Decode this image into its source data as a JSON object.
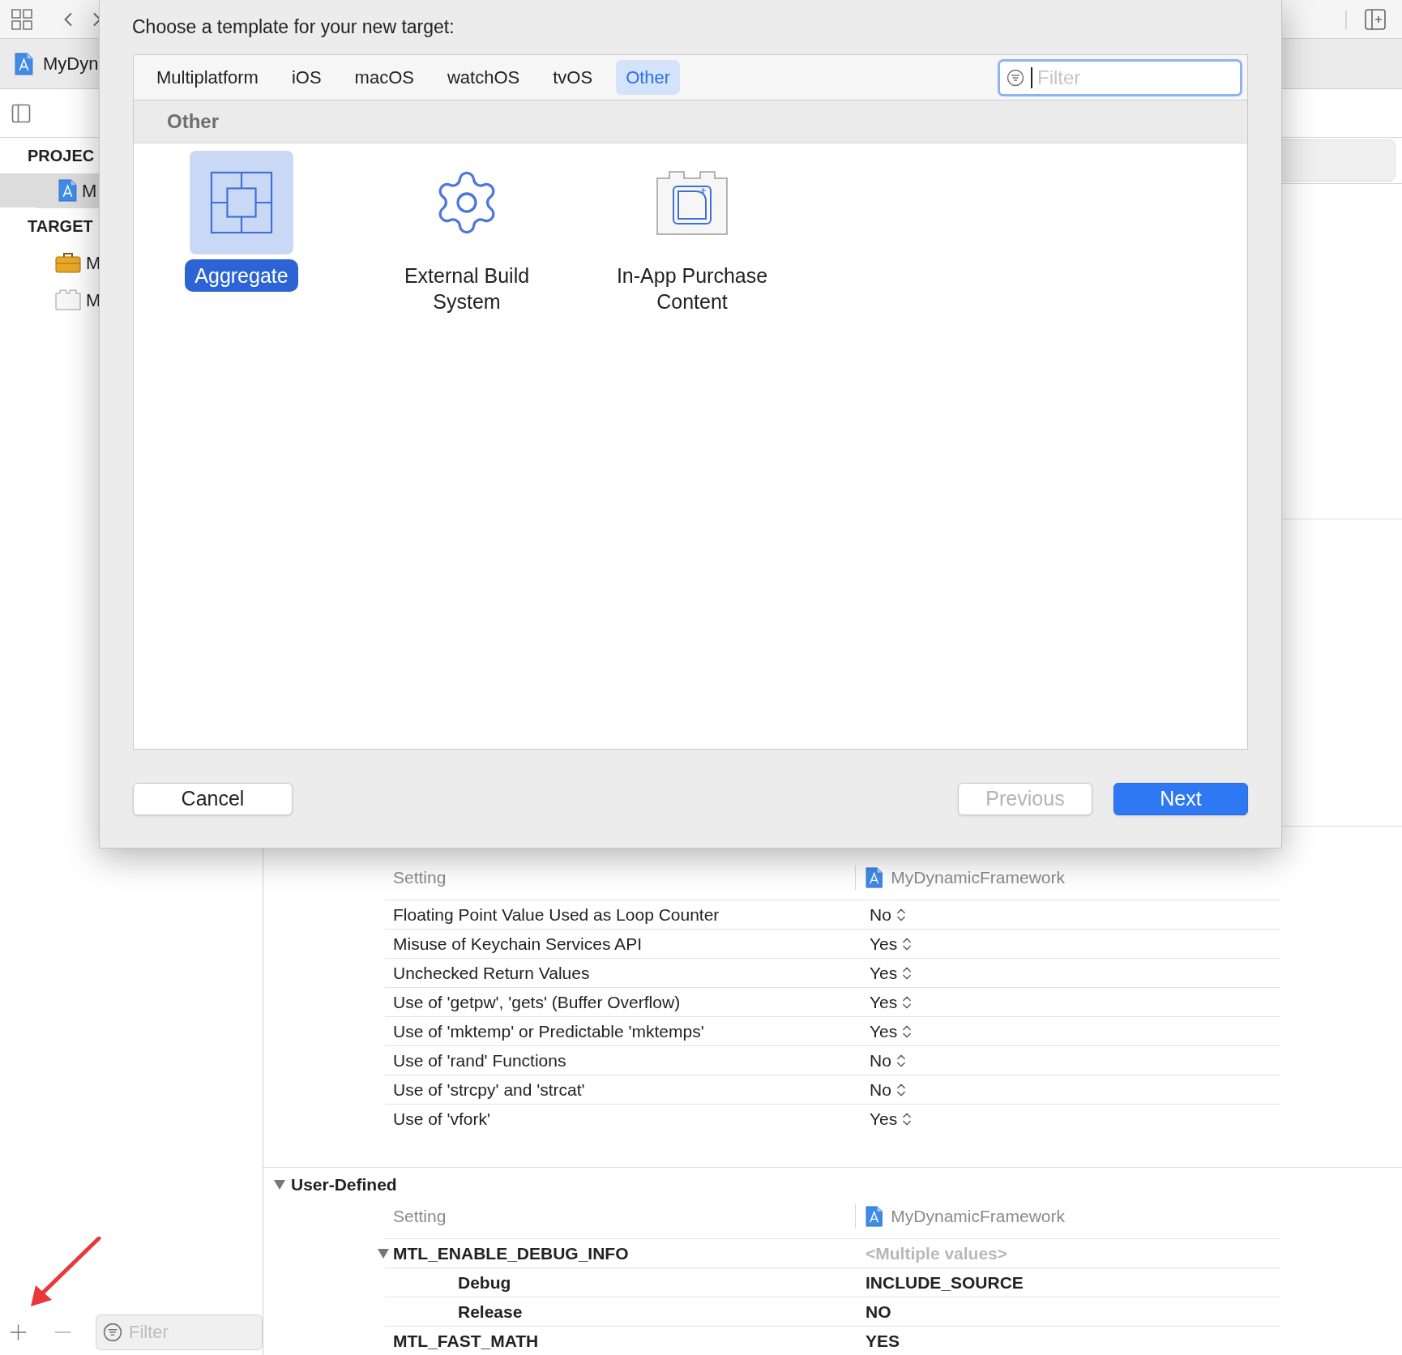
{
  "project_tab": {
    "title": "MyDyn"
  },
  "sidebar": {
    "sections": [
      {
        "title": "PROJEC",
        "items": [
          {
            "label": "M",
            "kind": "project",
            "selected": true
          }
        ]
      },
      {
        "title": "TARGET",
        "items": [
          {
            "label": "M",
            "kind": "toolbox",
            "selected": false
          },
          {
            "label": "M",
            "kind": "bundle",
            "selected": false
          }
        ]
      }
    ],
    "filter": {
      "placeholder": "Filter"
    }
  },
  "settings": {
    "sections": [
      {
        "header": {
          "setting": "Setting",
          "target": "MyDynamicFramework"
        },
        "rows": [
          {
            "name": "Floating Point Value Used as Loop Counter",
            "value": "No",
            "kind": "popup"
          },
          {
            "name": "Misuse of Keychain Services API",
            "value": "Yes",
            "kind": "popup"
          },
          {
            "name": "Unchecked Return Values",
            "value": "Yes",
            "kind": "popup"
          },
          {
            "name": "Use of 'getpw', 'gets' (Buffer Overflow)",
            "value": "Yes",
            "kind": "popup"
          },
          {
            "name": "Use of 'mktemp' or Predictable 'mktemps'",
            "value": "Yes",
            "kind": "popup"
          },
          {
            "name": "Use of 'rand' Functions",
            "value": "No",
            "kind": "popup"
          },
          {
            "name": "Use of 'strcpy' and 'strcat'",
            "value": "No",
            "kind": "popup"
          },
          {
            "name": "Use of 'vfork'",
            "value": "Yes",
            "kind": "popup"
          }
        ]
      },
      {
        "title": "User-Defined",
        "expanded": true,
        "header": {
          "setting": "Setting",
          "target": "MyDynamicFramework"
        },
        "rows": [
          {
            "name": "MTL_ENABLE_DEBUG_INFO",
            "value": "<Multiple values>",
            "kind": "mixed",
            "expanded": true,
            "children": [
              {
                "name": "Debug",
                "value": "INCLUDE_SOURCE",
                "kind": "bold"
              },
              {
                "name": "Release",
                "value": "NO",
                "kind": "bold"
              }
            ]
          },
          {
            "name": "MTL_FAST_MATH",
            "value": "YES",
            "kind": "bold"
          }
        ]
      }
    ]
  },
  "dialog": {
    "title": "Choose a template for your new target:",
    "tabs": [
      {
        "label": "Multiplatform",
        "selected": false
      },
      {
        "label": "iOS",
        "selected": false
      },
      {
        "label": "macOS",
        "selected": false
      },
      {
        "label": "watchOS",
        "selected": false
      },
      {
        "label": "tvOS",
        "selected": false
      },
      {
        "label": "Other",
        "selected": true
      }
    ],
    "filter": {
      "placeholder": "Filter"
    },
    "section": "Other",
    "templates": [
      {
        "label": "Aggregate",
        "kind": "aggregate",
        "selected": true
      },
      {
        "label": "External Build System",
        "kind": "external",
        "selected": false
      },
      {
        "label": "In-App Purchase Content",
        "kind": "inapp",
        "selected": false
      }
    ],
    "buttons": [
      {
        "label": "Cancel",
        "kind": "cancel",
        "disabled": false
      },
      {
        "label": "Previous",
        "kind": "previous",
        "disabled": true
      },
      {
        "label": "Next",
        "kind": "next",
        "disabled": false
      }
    ]
  }
}
